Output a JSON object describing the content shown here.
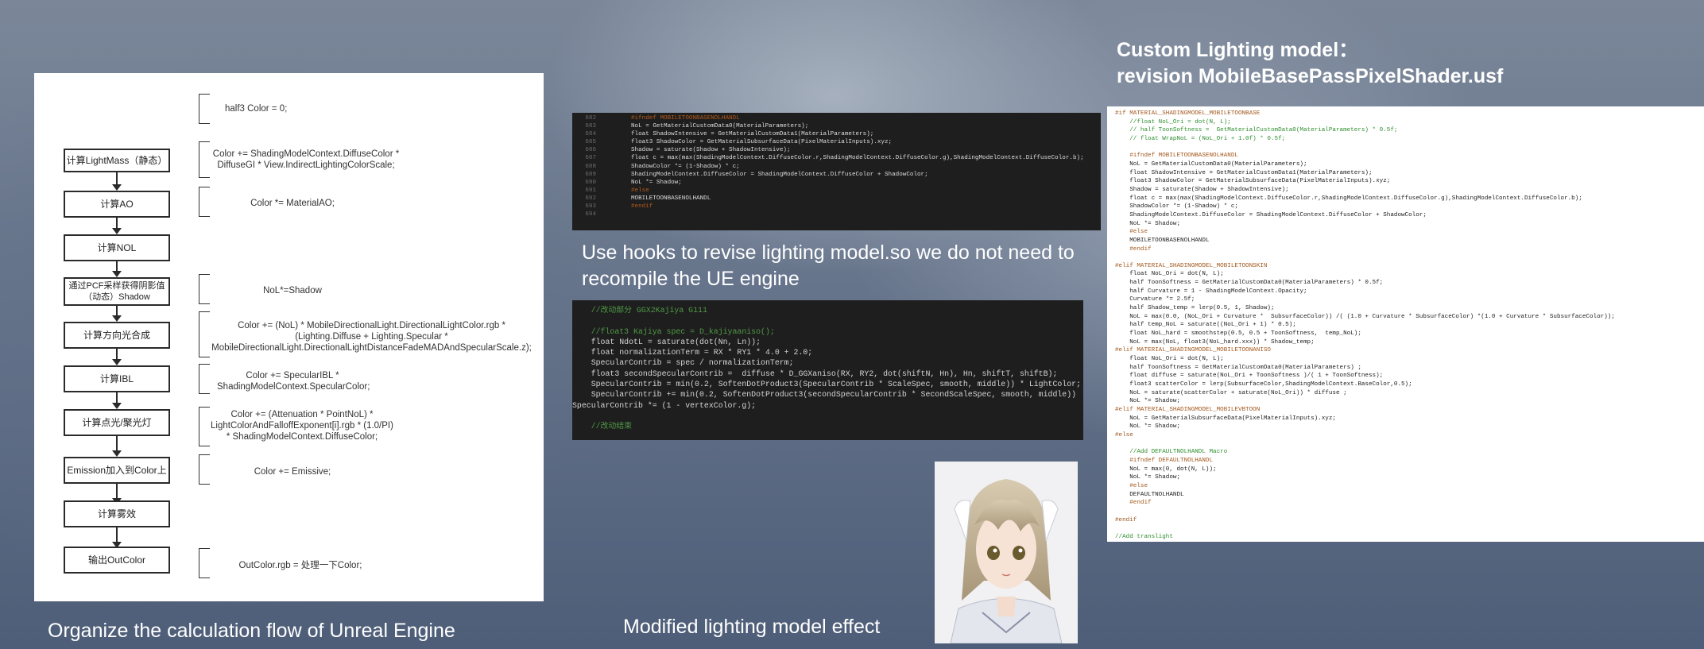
{
  "flowchart": {
    "steps": [
      "计算LightMass（静态）",
      "计算AO",
      "计算NOL",
      "通过PCF采样获得阴影值（动态）Shadow",
      "计算方向光合成",
      "计算IBL",
      "计算点光/聚光灯",
      "Emission加入到Color上",
      "计算雾效",
      "输出OutColor"
    ],
    "code_notes": [
      "half3 Color = 0;",
      "Color += ShadingModelContext.DiffuseColor * DiffuseGI * View.IndirectLightingColorScale;",
      "Color *= MaterialAO;",
      "NoL*=Shadow",
      "Color += (NoL) * MobileDirectionalLight.DirectionalLightColor.rgb * (Lighting.Diffuse + Lighting.Specular * MobileDirectionalLight.DirectionalLightDistanceFadeMADAndSpecularScale.z);",
      "Color += SpecularIBL * ShadingModelContext.SpecularColor;",
      "Color += (Attenuation * PointNoL) * LightColorAndFalloffExponent[i].rgb * (1.0/PI) * ShadingModelContext.DiffuseColor;",
      "Color += Emissive;",
      "OutColor.rgb = 处理一下Color;"
    ]
  },
  "code_panel_1": {
    "line_numbers": [
      "682",
      "683",
      "684",
      "685",
      "686",
      "687",
      "688",
      "689",
      "690",
      "691",
      "692",
      "693",
      "694"
    ],
    "lines": [
      "#ifndef MOBILETOONBASENOLHANDL",
      "NoL = GetMaterialCustomData0(MaterialParameters);",
      "float ShadowIntensive = GetMaterialCustomData1(MaterialParameters);",
      "float3 ShadowColor = GetMaterialSubsurfaceData(PixelMaterialInputs).xyz;",
      "Shadow = saturate(Shadow + ShadowIntensive);",
      "float c = max(max(ShadingModelContext.DiffuseColor.r,ShadingModelContext.DiffuseColor.g),ShadingModelContext.DiffuseColor.b);",
      "ShadowColor *= (1-Shadow) * c;",
      "ShadingModelContext.DiffuseColor = ShadingModelContext.DiffuseColor + ShadowColor;",
      "NoL *= Shadow;",
      "#else",
      "MOBILETOONBASENOLHANDL",
      "#endif",
      ""
    ]
  },
  "captions": {
    "hooks": "Use hooks to revise lighting model.so we do not need to recompile the UE engine",
    "custom_line1": "Custom Lighting model：",
    "custom_line2": "revision MobileBasePassPixelShader.usf",
    "organize": "Organize the calculation flow of Unreal Engine",
    "effect": "Modified lighting model effect"
  },
  "code_panel_2": {
    "lines": [
      "    //改动部分 GGX2Kajiya G111",
      "",
      "    //float3 Kajiya spec = D_kajiyaaniso();",
      "    float NdotL = saturate(dot(Nn, Ln));",
      "    float normalizationTerm = RX * RY1 * 4.0 + 2.0;",
      "    SpecularContrib = spec / normalizationTerm;",
      "    float3 secondSpecularContrib =  diffuse * D_GGXaniso(RX, RY2, dot(shiftN, Hn), Hn, shiftT, shiftB);",
      "    SpecularContrib = min(0.2, SoftenDotProduct3(SpecularContrib * ScaleSpec, smooth, middle)) * LightColor;",
      "    SpecularContrib += min(0.2, SoftenDotProduct3(secondSpecularContrib * SecondScaleSpec, smooth, middle))",
      "SpecularContrib *= (1 - vertexColor.g);",
      "",
      "    //改动结束"
    ]
  },
  "code_panel_3": {
    "lines": [
      "#if MATERIAL_SHADINGMODEL_MOBILETOONBASE",
      "    //float NoL_Ori = dot(N, L);",
      "    // half ToonSoftness =  GetMaterialCustomData0(MaterialParameters) * 0.5f;",
      "    // float WrapNoL = (NoL_Ori + 1.0f) * 0.5f;",
      "",
      "    #ifndef MOBILETOONBASENOLHANDL",
      "    NoL = GetMaterialCustomData0(MaterialParameters);",
      "    float ShadowIntensive = GetMaterialCustomData1(MaterialParameters);",
      "    float3 ShadowColor = GetMaterialSubsurfaceData(PixelMaterialInputs).xyz;",
      "    Shadow = saturate(Shadow + ShadowIntensive);",
      "    float c = max(max(ShadingModelContext.DiffuseColor.r,ShadingModelContext.DiffuseColor.g),ShadingModelContext.DiffuseColor.b);",
      "    ShadowColor *= (1-Shadow) * c;",
      "    ShadingModelContext.DiffuseColor = ShadingModelContext.DiffuseColor + ShadowColor;",
      "    NoL *= Shadow;",
      "    #else",
      "    MOBILETOONBASENOLHANDL",
      "    #endif",
      "",
      "#elif MATERIAL_SHADINGMODEL_MOBILETOONSKIN",
      "    float NoL_Ori = dot(N, L);",
      "    half ToonSoftness = GetMaterialCustomData0(MaterialParameters) * 0.5f;",
      "    half Curvature = 1 - ShadingModelContext.Opacity;",
      "    Curvature *= 2.5f;",
      "    half Shadow_temp = lerp(0.5, 1, Shadow);",
      "    NoL = max(0.0, (NoL_Ori + Curvature *  SubsurfaceColor)) /( (1.0 + Curvature * SubsurfaceColor) *(1.0 + Curvature * SubsurfaceColor));",
      "    half temp_NoL = saturate((NoL_Ori + 1) * 0.5);",
      "    float NoL_hard = smoothstep(0.5, 0.5 + ToonSoftness,  temp_NoL);",
      "    NoL = max(NoL, float3(NoL_hard.xxx)) * Shadow_temp;",
      "#elif MATERIAL_SHADINGMODEL_MOBILETOONANISO",
      "    float NoL_Ori = dot(N, L);",
      "    half ToonSoftness = GetMaterialCustomData0(MaterialParameters) ;",
      "    float diffuse = saturate(NoL_Ori + ToonSoftness )/( 1 + ToonSoftness);",
      "    float3 scatterColor = lerp(SubsurfaceColor,ShadingModelContext.BaseColor,0.5);",
      "    NoL = saturate(scatterColor + saturate(NoL_Ori)) * diffuse ;",
      "    NoL *= Shadow;",
      "#elif MATERIAL_SHADINGMODEL_MOBILEVBTOON",
      "    NoL = GetMaterialSubsurfaceData(PixelMaterialInputs).xyz;",
      "    NoL *= Shadow;",
      "#else",
      "",
      "    //Add DEFAULTNOLHANDL Macro",
      "    #ifndef DEFAULTNOLHANDL",
      "    NoL = max(0, dot(N, L));",
      "    NoL *= Shadow;",
      "    #else",
      "    DEFAULTNOLHANDL",
      "    #endif",
      "",
      "#endif",
      "",
      "//Add translight"
    ]
  },
  "colors": {
    "code_bg": "#1e1e1e",
    "caption": "#ffffff",
    "keyword": "#3b6fd6",
    "comment": "#4e9a45",
    "macro": "#b15a1b"
  }
}
